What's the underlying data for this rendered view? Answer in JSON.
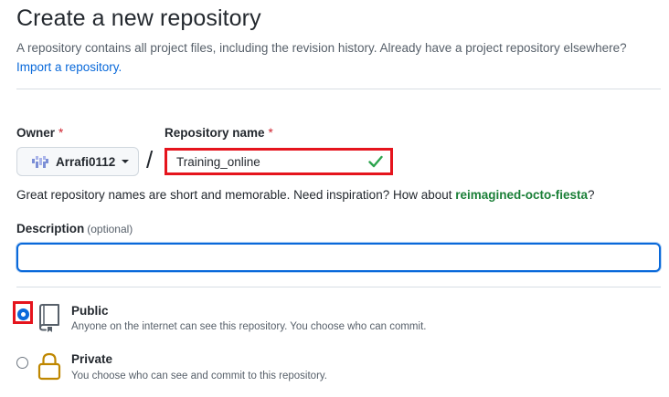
{
  "header": {
    "title": "Create a new repository",
    "subtitle": "A repository contains all project files, including the revision history. Already have a project repository elsewhere?",
    "import_link": "Import a repository."
  },
  "owner": {
    "label": "Owner",
    "required_mark": "*",
    "value": "Arrafi0112",
    "avatar_icon": "identicon-icon"
  },
  "separator": "/",
  "repo_name": {
    "label": "Repository name",
    "required_mark": "*",
    "value": "Training_online",
    "status_icon": "check-icon",
    "status_color": "#2da44e"
  },
  "hint": {
    "text": "Great repository names are short and memorable. Need inspiration? How about ",
    "suggestion": "reimagined-octo-fiesta",
    "suffix": "?"
  },
  "description": {
    "label": "Description",
    "optional": "(optional)",
    "value": ""
  },
  "visibility": {
    "options": [
      {
        "title": "Public",
        "desc": "Anyone on the internet can see this repository. You choose who can commit.",
        "icon": "repo-icon",
        "selected": true
      },
      {
        "title": "Private",
        "desc": "You choose who can see and commit to this repository.",
        "icon": "lock-icon",
        "selected": false
      }
    ]
  },
  "colors": {
    "accent": "#0969da",
    "success": "#1a7f37",
    "highlight": "#e5141d",
    "lock": "#bf8700"
  }
}
